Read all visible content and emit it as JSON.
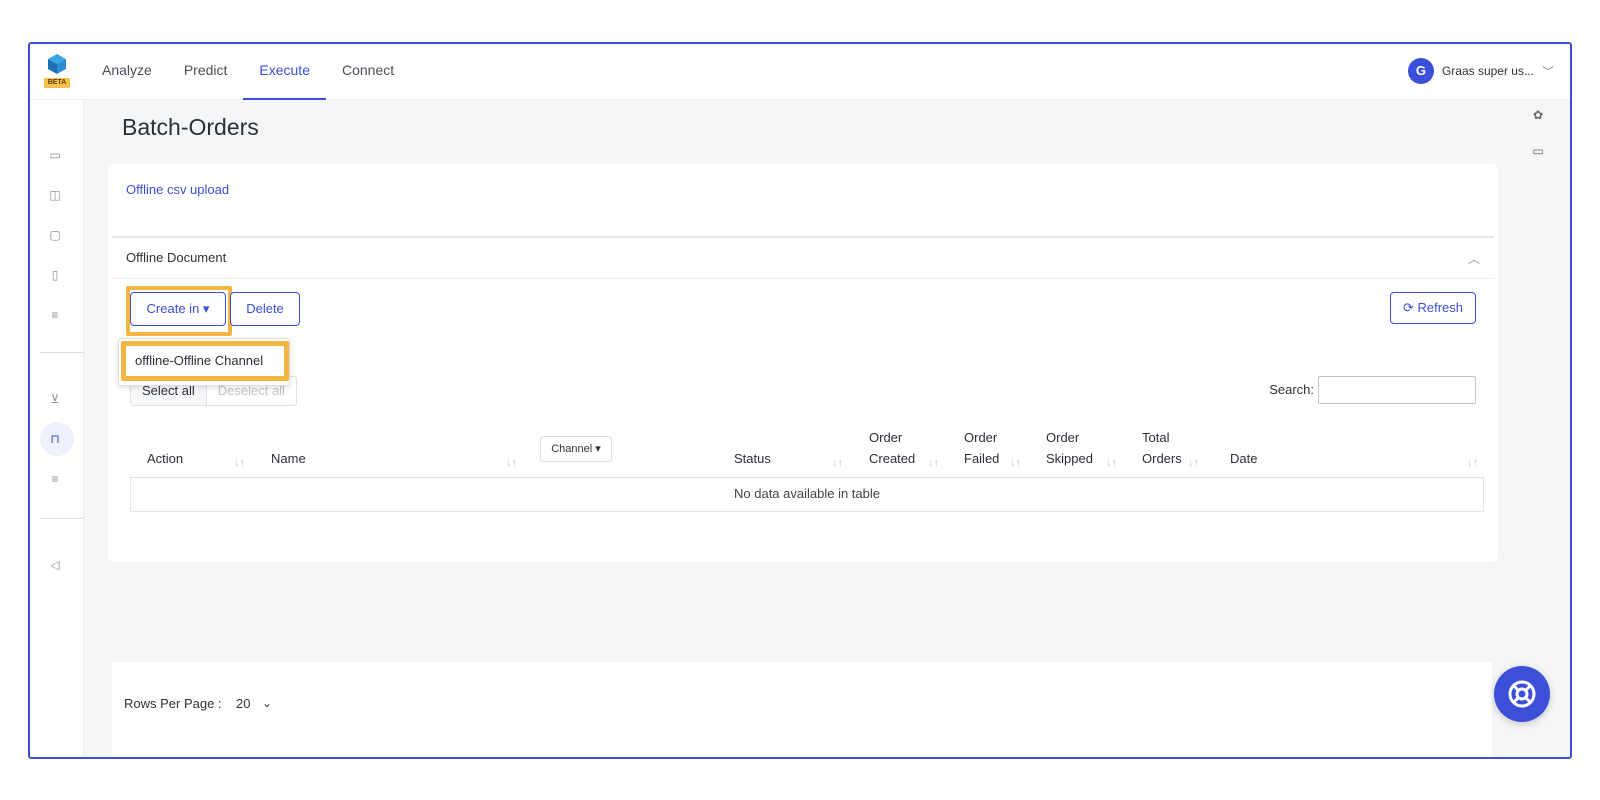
{
  "nav": {
    "logo_badge": "BETA",
    "tabs": [
      {
        "label": "Analyze"
      },
      {
        "label": "Predict"
      },
      {
        "label": "Execute"
      },
      {
        "label": "Connect"
      }
    ],
    "active_tab": "Execute",
    "user": {
      "initial": "G",
      "name": "Graas super us..."
    }
  },
  "sidebar": {
    "icons": [
      "archive-icon",
      "map-icon",
      "calendar-check-icon",
      "file-plus-icon",
      "document-icon",
      "cart-icon",
      "shopping-bag-icon",
      "list-icon",
      "megaphone-icon"
    ],
    "active_icon": "shopping-bag-icon"
  },
  "page": {
    "title": "Batch-Orders",
    "upload_link": "Offline csv upload",
    "section_title": "Offline Document"
  },
  "toolbar": {
    "create_label": "Create in ▾",
    "delete_label": "Delete",
    "refresh_label": "Refresh",
    "dropdown_item": "offline-Offline Channel",
    "select_all": "Select all",
    "deselect_all": "Deselect all",
    "search_label": "Search:",
    "search_value": ""
  },
  "table": {
    "columns": [
      {
        "label": "Action"
      },
      {
        "label": "Name"
      },
      {
        "label": "Channel ▾"
      },
      {
        "label": "Status"
      },
      {
        "label": "Order Created"
      },
      {
        "label": "Order Failed"
      },
      {
        "label": "Order Skipped"
      },
      {
        "label": "Total Orders"
      },
      {
        "label": "Date"
      }
    ],
    "empty_message": "No data available in table"
  },
  "footer": {
    "rows_label": "Rows Per Page :",
    "rows_value": "20"
  },
  "colors": {
    "accent": "#3b4fd8",
    "highlight": "#f4b642"
  }
}
